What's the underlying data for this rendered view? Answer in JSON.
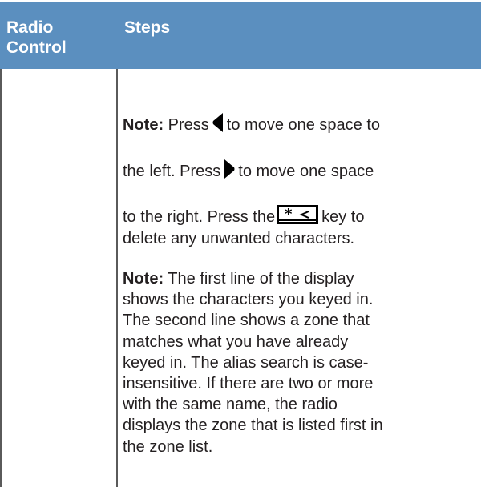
{
  "table": {
    "headers": [
      "Radio Control",
      "Steps"
    ],
    "header_col1_line1": "Radio",
    "header_col1_line2": "Control",
    "header_col2": "Steps"
  },
  "note1": {
    "label": "Note:",
    "l1_a": "Press",
    "l1_b": "to move one space to",
    "l2_a": "the left. Press",
    "l2_b": "to move one space",
    "l3_a": "to the right. Press the",
    "l3_b": "key to",
    "l4": "delete any unwanted characters.",
    "icons": [
      "left-arrow-icon",
      "right-arrow-icon",
      "star-backspace-key-icon"
    ]
  },
  "note2": {
    "label": "Note:",
    "lines": [
      " The first line of the display",
      "shows the characters you keyed in.",
      "The second line shows a zone that",
      "matches what you have already",
      "keyed in. The alias search is case-",
      "insensitive. If there are two or more",
      "with the same name, the radio",
      "displays the zone that is listed first in",
      "the zone list."
    ]
  },
  "colors": {
    "header_bg": "#5b8fbf",
    "header_text": "#ffffff",
    "body_text": "#231f20"
  }
}
